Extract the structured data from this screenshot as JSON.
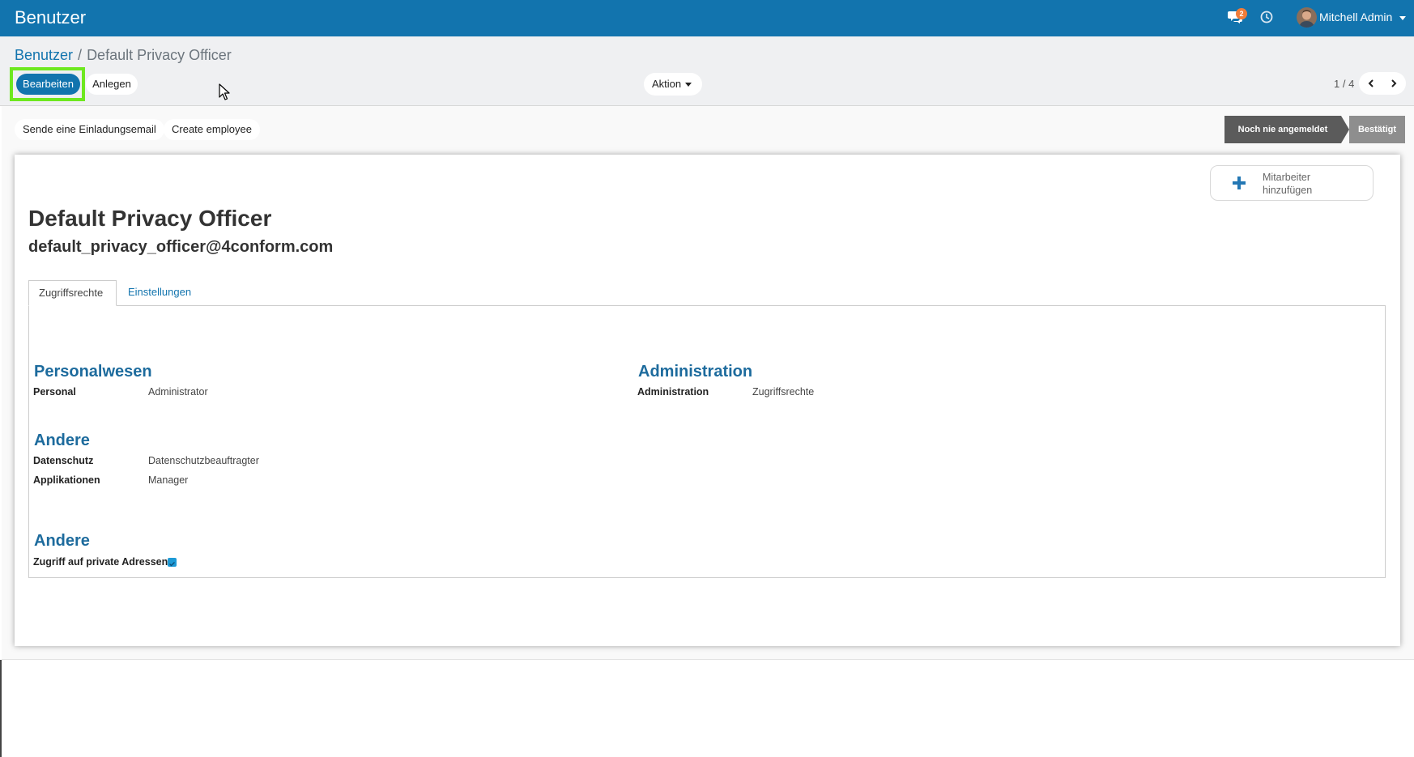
{
  "topbar": {
    "app_title": "Benutzer",
    "chat_icon": "chat-icon",
    "chat_badge": "2",
    "clock_icon": "clock-icon",
    "user_name": "Mitchell Admin",
    "colors": {
      "bar": "#1274ae",
      "badge": "#f07c39"
    }
  },
  "breadcrumb": {
    "parent": "Benutzer",
    "separator": "/",
    "current": "Default Privacy Officer"
  },
  "toolbar": {
    "edit_label": "Bearbeiten",
    "create_label": "Anlegen",
    "action_label": "Aktion",
    "pager": "1 / 4"
  },
  "statusbar": {
    "buttons": [
      "Sende eine Einladungsemail",
      "Create employee"
    ],
    "stages": [
      "Noch nie angemeldet",
      "Bestätigt"
    ],
    "active_stage": "Noch nie angemeldet"
  },
  "record": {
    "smart_button": "Mitarbeiter hinzufügen",
    "name": "Default Privacy Officer",
    "email": "default_privacy_officer@4conform.com"
  },
  "tabs": [
    "Zugriffsrechte",
    "Einstellungen"
  ],
  "groups": {
    "personalwesen": {
      "title": "Personalwesen",
      "fields": [
        {
          "label": "Personal",
          "value": "Administrator"
        }
      ]
    },
    "administration": {
      "title": "Administration",
      "fields": [
        {
          "label": "Administration",
          "value": "Zugriffsrechte"
        }
      ]
    },
    "andere1": {
      "title": "Andere",
      "fields": [
        {
          "label": "Datenschutz",
          "value": "Datenschutzbeauftragter"
        },
        {
          "label": "Applikationen",
          "value": "Manager"
        }
      ]
    },
    "andere2": {
      "title": "Andere",
      "fields": [
        {
          "label": "Zugriff auf private Adressen",
          "checked": true
        }
      ]
    }
  }
}
